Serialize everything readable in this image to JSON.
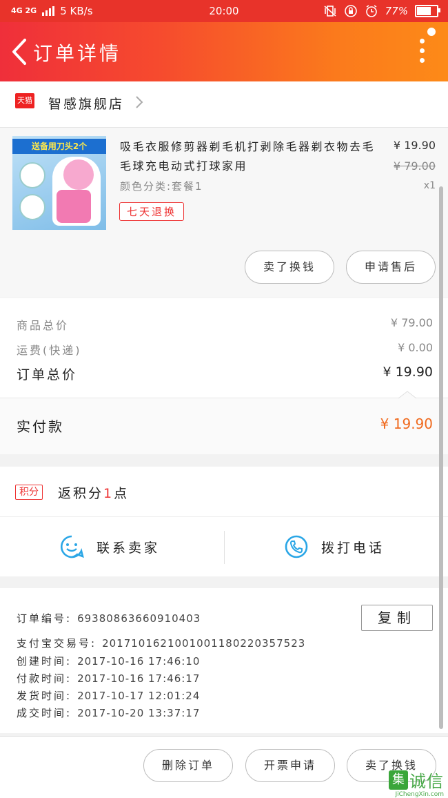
{
  "status_bar": {
    "network": "4G 2G",
    "speed": "5 KB/s",
    "time": "20:00",
    "battery_percent": 77,
    "battery_label": "77%"
  },
  "nav": {
    "title": "订单详情"
  },
  "shop": {
    "badge": "天猫",
    "name": "智感旗舰店"
  },
  "product": {
    "image_banner": "送备用刀头2个",
    "title": "吸毛衣服修剪器剃毛机打剥除毛器剃衣物去毛毛球充电动式打球家用",
    "spec": "颜色分类:套餐1",
    "tag": "七天退换",
    "price": "¥ 19.90",
    "original_price": "¥ 79.00",
    "quantity": "x1",
    "buttons": [
      "卖了换钱",
      "申请售后"
    ]
  },
  "summary": {
    "goods_total_label": "商品总价",
    "goods_total": "¥ 79.00",
    "shipping_label": "运费(快递)",
    "shipping": "¥ 0.00",
    "order_total_label": "订单总价",
    "order_total": "¥ 19.90",
    "paid_label": "实付款",
    "paid": "¥ 19.90"
  },
  "points": {
    "badge": "积分",
    "prefix": "返积分",
    "count": "1",
    "suffix": "点"
  },
  "contact": {
    "seller_label": "联系卖家",
    "call_label": "拨打电话"
  },
  "order_info": {
    "copy_label": "复制",
    "rows": [
      {
        "label": "订单编号:",
        "value": "69380863660910403"
      },
      {
        "label": "支付宝交易号:",
        "value": "2017101621001001180220357523"
      },
      {
        "label": "创建时间:",
        "value": "2017-10-16 17:46:10"
      },
      {
        "label": "付款时间:",
        "value": "2017-10-16 17:46:17"
      },
      {
        "label": "发货时间:",
        "value": "2017-10-17 12:01:24"
      },
      {
        "label": "成交时间:",
        "value": "2017-10-20 13:37:17"
      }
    ]
  },
  "bottom_bar": {
    "buttons": [
      "删除订单",
      "开票申请",
      "卖了换钱"
    ]
  },
  "watermark": {
    "mark": "集",
    "text": "诚信",
    "url": "JiChengXin.com"
  },
  "colors": {
    "accent_red": "#e33333",
    "price_orange": "#f06a1e",
    "icon_blue": "#2aa6e6"
  }
}
